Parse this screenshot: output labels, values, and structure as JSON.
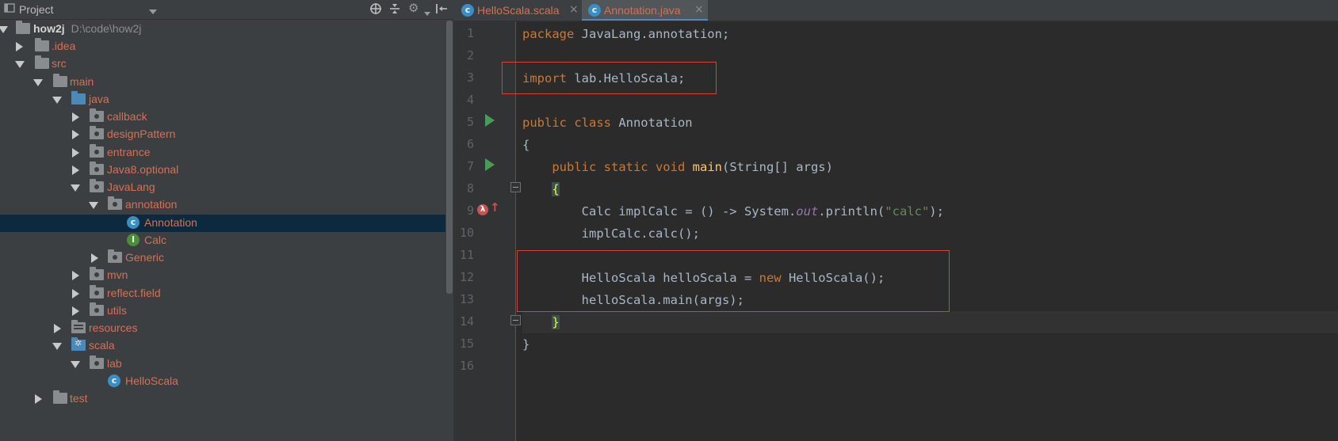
{
  "project_panel": {
    "title": "Project",
    "icons": [
      "chevron-down-icon",
      "target-icon",
      "collapse-icon",
      "gear-icon",
      "pin-icon"
    ],
    "tree": [
      {
        "label": "how2j",
        "path": "D:\\code\\how2j",
        "expanded": true,
        "icon": "module-folder-icon"
      },
      {
        "label": ".idea",
        "expanded": false,
        "icon": "folder-icon"
      },
      {
        "label": "src",
        "expanded": true,
        "icon": "folder-icon"
      },
      {
        "label": "main",
        "expanded": true,
        "icon": "folder-icon"
      },
      {
        "label": "java",
        "expanded": true,
        "icon": "source-folder-icon"
      },
      {
        "label": "callback",
        "expanded": false,
        "icon": "package-icon"
      },
      {
        "label": "designPattern",
        "expanded": false,
        "icon": "package-icon"
      },
      {
        "label": "entrance",
        "expanded": false,
        "icon": "package-icon"
      },
      {
        "label": "Java8.optional",
        "expanded": false,
        "icon": "package-icon"
      },
      {
        "label": "JavaLang",
        "expanded": true,
        "icon": "package-icon"
      },
      {
        "label": "annotation",
        "expanded": true,
        "icon": "package-icon"
      },
      {
        "label": "Annotation",
        "selected": true,
        "icon": "class-icon"
      },
      {
        "label": "Calc",
        "icon": "interface-icon"
      },
      {
        "label": "Generic",
        "expanded": false,
        "icon": "package-icon"
      },
      {
        "label": "mvn",
        "expanded": false,
        "icon": "package-icon"
      },
      {
        "label": "reflect.field",
        "expanded": false,
        "icon": "package-icon"
      },
      {
        "label": "utils",
        "expanded": false,
        "icon": "package-icon"
      },
      {
        "label": "resources",
        "expanded": false,
        "icon": "resources-folder-icon"
      },
      {
        "label": "scala",
        "expanded": true,
        "icon": "scala-folder-icon"
      },
      {
        "label": "lab",
        "expanded": true,
        "icon": "package-icon"
      },
      {
        "label": "HelloScala",
        "icon": "scala-class-icon"
      },
      {
        "label": "test",
        "expanded": false,
        "icon": "folder-icon"
      }
    ]
  },
  "editor": {
    "tabs": [
      {
        "label": "HelloScala.scala",
        "active": false,
        "close": "×"
      },
      {
        "label": "Annotation.java",
        "active": true,
        "close": "×"
      }
    ],
    "line_numbers": [
      "1",
      "2",
      "3",
      "4",
      "5",
      "6",
      "7",
      "8",
      "9",
      "10",
      "11",
      "12",
      "13",
      "14",
      "15",
      "16"
    ],
    "code": {
      "l1_kw": "package",
      "l1_rest": " JavaLang.annotation;",
      "l3_kw": "import",
      "l3_rest": " lab.HelloScala;",
      "l5_kw": "public class",
      "l5_rest": " Annotation",
      "l6": "{",
      "l7_indent": "    ",
      "l7_kw": "public static void",
      "l7_sp": " ",
      "l7_fn": "main",
      "l7_rest": "(String[] args)",
      "l8_indent": "    ",
      "l8_br": "{",
      "l9_a": "        Calc implCalc = () -> System.",
      "l9_out": "out",
      "l9_b": ".println(",
      "l9_str": "\"calc\"",
      "l9_c": ");",
      "l10": "        implCalc.calc();",
      "l12_a": "        HelloScala helloScala = ",
      "l12_kw": "new",
      "l12_b": " HelloScala();",
      "l13": "        helloScala.main(args);",
      "l14_indent": "    ",
      "l14_br": "}",
      "l15": "}"
    }
  }
}
